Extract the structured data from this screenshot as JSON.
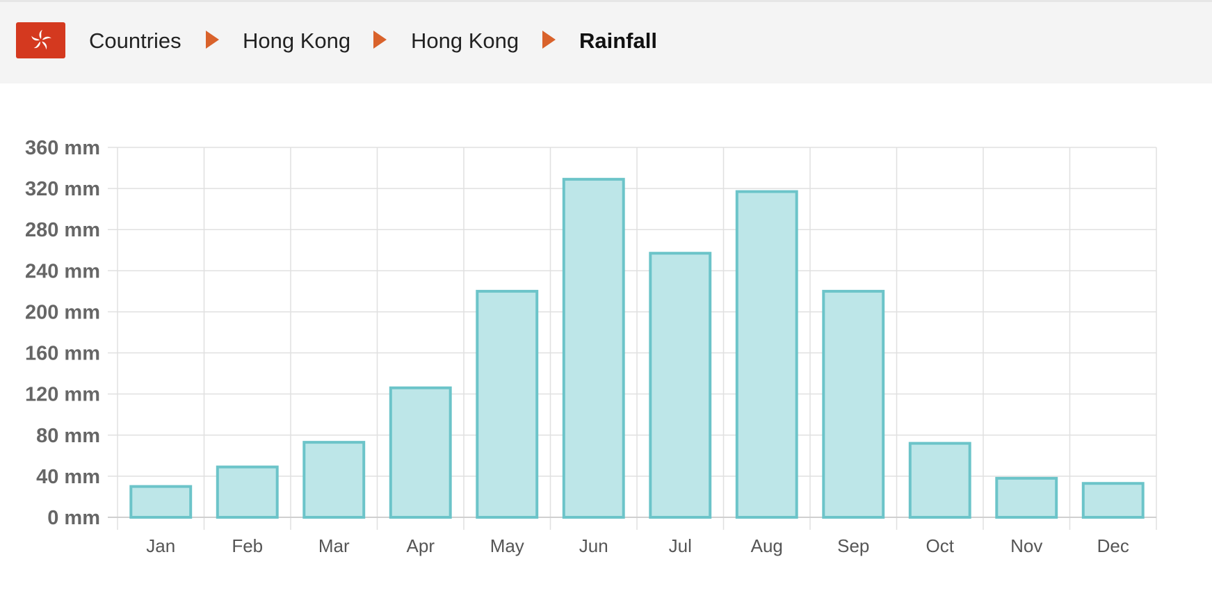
{
  "breadcrumb": {
    "items": [
      "Countries",
      "Hong Kong",
      "Hong Kong",
      "Rainfall"
    ],
    "flag_icon": "hong-kong-flag-icon",
    "separator_icon": "triangle-right-icon"
  },
  "colors": {
    "flag_red": "#d4391f",
    "separator": "#d9622b",
    "bar_fill": "#bde6e8",
    "bar_stroke": "#6cc4c9",
    "grid": "#e0e0e0"
  },
  "chart_data": {
    "type": "bar",
    "categories": [
      "Jan",
      "Feb",
      "Mar",
      "Apr",
      "May",
      "Jun",
      "Jul",
      "Aug",
      "Sep",
      "Oct",
      "Nov",
      "Dec"
    ],
    "values": [
      30,
      49,
      73,
      126,
      220,
      329,
      257,
      317,
      220,
      72,
      38,
      33
    ],
    "ylim": [
      0,
      360
    ],
    "yticks": [
      0,
      40,
      80,
      120,
      160,
      200,
      240,
      280,
      320,
      360
    ],
    "ytick_unit": "mm",
    "grid": true,
    "legend": "none"
  }
}
